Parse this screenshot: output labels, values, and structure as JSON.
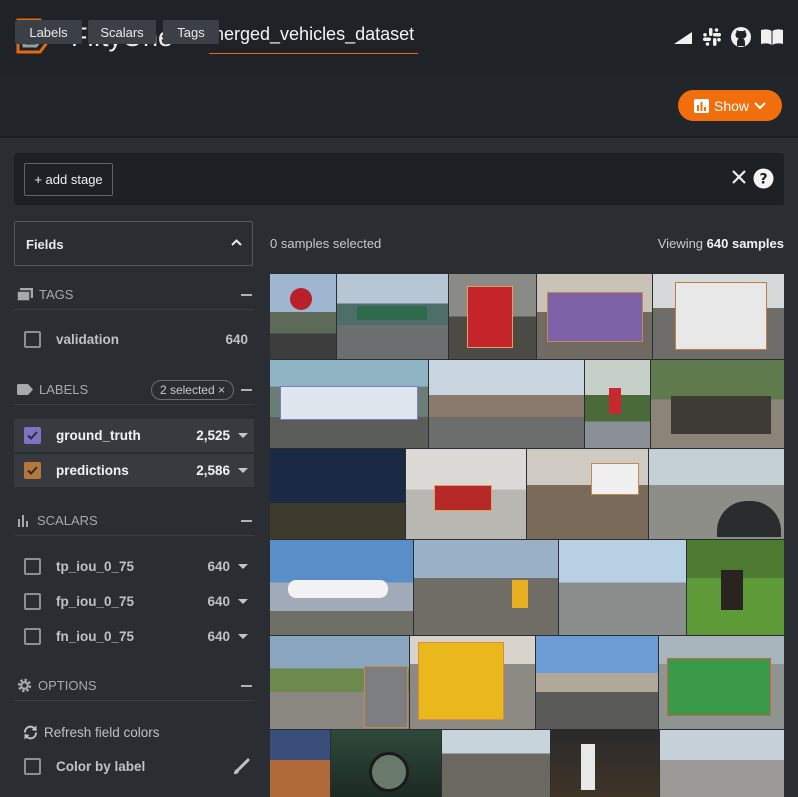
{
  "app": {
    "brand": "FiftyOne",
    "dataset_name": "merged_vehicles_dataset"
  },
  "header_icons": [
    "signal-icon",
    "slack-icon",
    "github-icon",
    "docs-icon"
  ],
  "toolbar": {
    "tabs": [
      "Labels",
      "Scalars",
      "Tags"
    ],
    "show_label": "Show"
  },
  "stages": {
    "add_label": "+ add stage"
  },
  "sidebar": {
    "fields_label": "Fields",
    "tags": {
      "title": "TAGS",
      "items": [
        {
          "label": "validation",
          "count": "640"
        }
      ]
    },
    "labels": {
      "title": "LABELS",
      "selected_pill": "2 selected ×",
      "items": [
        {
          "label": "ground_truth",
          "count": "2,525",
          "color": "#7d72c4"
        },
        {
          "label": "predictions",
          "count": "2,586",
          "color": "#b5783a"
        }
      ]
    },
    "scalars": {
      "title": "SCALARS",
      "items": [
        {
          "label": "tp_iou_0_75",
          "count": "640"
        },
        {
          "label": "fp_iou_0_75",
          "count": "640"
        },
        {
          "label": "fn_iou_0_75",
          "count": "640"
        }
      ]
    },
    "options": {
      "title": "OPTIONS",
      "refresh_label": "Refresh field colors",
      "color_by_label": "Color by label"
    }
  },
  "grid": {
    "selected_text": "0 samples selected",
    "viewing_prefix": "Viewing ",
    "viewing_count": "640 samples"
  },
  "colors": {
    "accent": "#f06e0c",
    "background": "#2a2e33",
    "header": "#1f2226"
  }
}
